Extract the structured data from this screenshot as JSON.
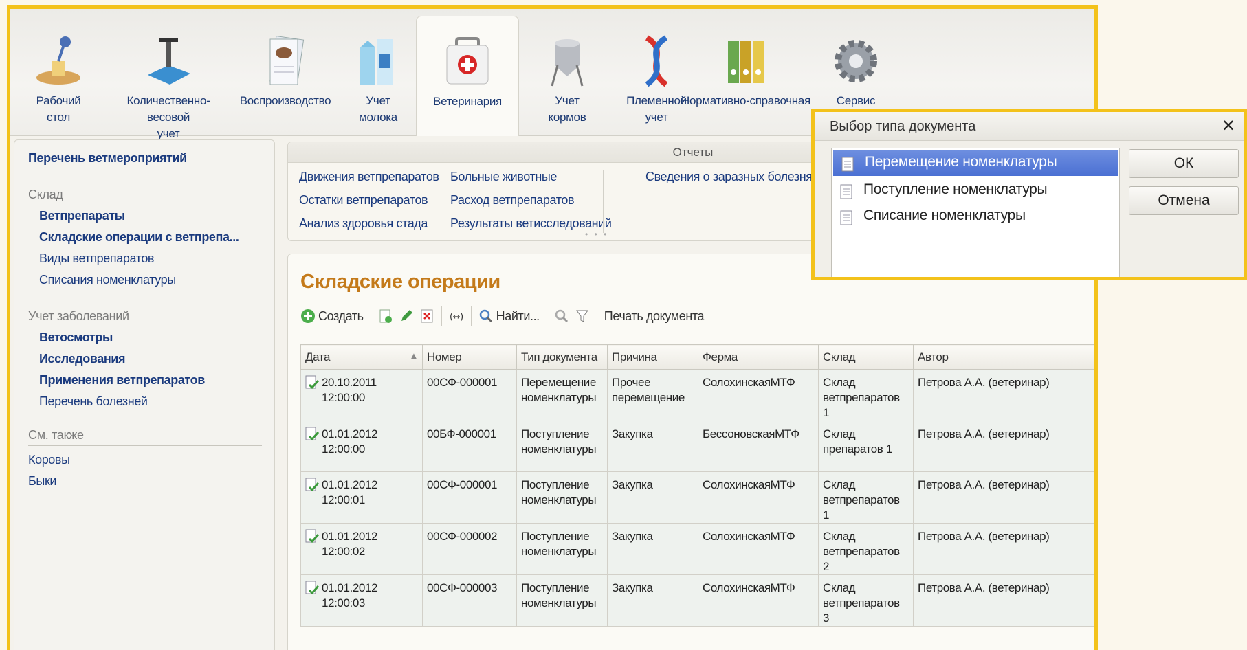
{
  "sections": [
    {
      "label": "Рабочий\nстол",
      "icon": "desk-lamp-icon"
    },
    {
      "label": "Количественно-весовой\nучет",
      "icon": "scales-icon"
    },
    {
      "label": "Воспроизводство",
      "icon": "cow-documents-icon"
    },
    {
      "label": "Учет\nмолока",
      "icon": "milk-cartons-icon"
    },
    {
      "label": "Ветеринария",
      "icon": "first-aid-kit-icon"
    },
    {
      "label": "Учет\nкормов",
      "icon": "silo-icon"
    },
    {
      "label": "Племенной\nучет",
      "icon": "dna-icon"
    },
    {
      "label": "Нормативно-справочная",
      "icon": "binders-icon"
    },
    {
      "label": "Сервис",
      "icon": "gear-icon"
    }
  ],
  "leftnav": {
    "top_link": "Перечень ветмероприятий",
    "group_sklad": "Склад",
    "sklad_items": [
      "Ветпрепараты",
      "Складские операции с ветпрепа...",
      "Виды ветпрепаратов",
      "Списания номенклатуры"
    ],
    "group_disease": "Учет заболеваний",
    "disease_items": [
      "Ветосмотры",
      "Исследования",
      "Применения ветпрепаратов",
      "Перечень болезней"
    ],
    "see_also": "См. также",
    "see_also_items": [
      "Коровы",
      "Быки"
    ]
  },
  "reports": {
    "title": "Отчеты",
    "col1": [
      "Движения ветпрепаратов",
      "Остатки ветпрепаратов",
      "Анализ здоровья стада"
    ],
    "col2": [
      "Больные животные",
      "Расход ветпрепаратов",
      "Результаты ветисследований"
    ],
    "col3": [
      "Сведения о заразных болезня"
    ]
  },
  "content": {
    "title": "Складские операции",
    "toolbar": {
      "create": "Создать",
      "find": "Найти...",
      "print": "Печать документа"
    },
    "columns": [
      "Дата",
      "Номер",
      "Тип документа",
      "Причина",
      "Ферма",
      "Склад",
      "Автор"
    ],
    "rows": [
      {
        "date": "20.10.2011",
        "time": "12:00:00",
        "number": "00СФ-000001",
        "type1": "Перемещение",
        "type2": "номенклатуры",
        "reason1": "Прочее",
        "reason2": "перемещение",
        "farm": "СолохинскаяМТФ",
        "wh1": "Склад",
        "wh2": "ветпрепаратов",
        "wh3": "1",
        "author": "Петрова А.А. (ветеринар)"
      },
      {
        "date": "01.01.2012",
        "time": "12:00:00",
        "number": "00БФ-000001",
        "type1": "Поступление",
        "type2": "номенклатуры",
        "reason1": "Закупка",
        "reason2": "",
        "farm": "БессоновскаяМТФ",
        "wh1": "Склад",
        "wh2": "препаратов 1",
        "wh3": "",
        "author": "Петрова А.А. (ветеринар)"
      },
      {
        "date": "01.01.2012",
        "time": "12:00:01",
        "number": "00СФ-000001",
        "type1": "Поступление",
        "type2": "номенклатуры",
        "reason1": "Закупка",
        "reason2": "",
        "farm": "СолохинскаяМТФ",
        "wh1": "Склад",
        "wh2": "ветпрепаратов",
        "wh3": "1",
        "author": "Петрова А.А. (ветеринар)"
      },
      {
        "date": "01.01.2012",
        "time": "12:00:02",
        "number": "00СФ-000002",
        "type1": "Поступление",
        "type2": "номенклатуры",
        "reason1": "Закупка",
        "reason2": "",
        "farm": "СолохинскаяМТФ",
        "wh1": "Склад",
        "wh2": "ветпрепаратов",
        "wh3": "2",
        "author": "Петрова А.А. (ветеринар)"
      },
      {
        "date": "01.01.2012",
        "time": "12:00:03",
        "number": "00СФ-000003",
        "type1": "Поступление",
        "type2": "номенклатуры",
        "reason1": "Закупка",
        "reason2": "",
        "farm": "СолохинскаяМТФ",
        "wh1": "Склад",
        "wh2": "ветпрепаратов",
        "wh3": "3",
        "author": "Петрова А.А. (ветеринар)"
      }
    ]
  },
  "dialog": {
    "title": "Выбор типа документа",
    "close": "✕",
    "items": [
      "Перемещение номенклатуры",
      "Поступление номенклатуры",
      "Списание номенклатуры"
    ],
    "ok": "ОК",
    "cancel": "Отмена"
  },
  "colors": {
    "accent_frame": "#f3c21b",
    "title_orange": "#c47a1a",
    "link_blue": "#1a3a7e",
    "selection": "#4b70d3"
  }
}
